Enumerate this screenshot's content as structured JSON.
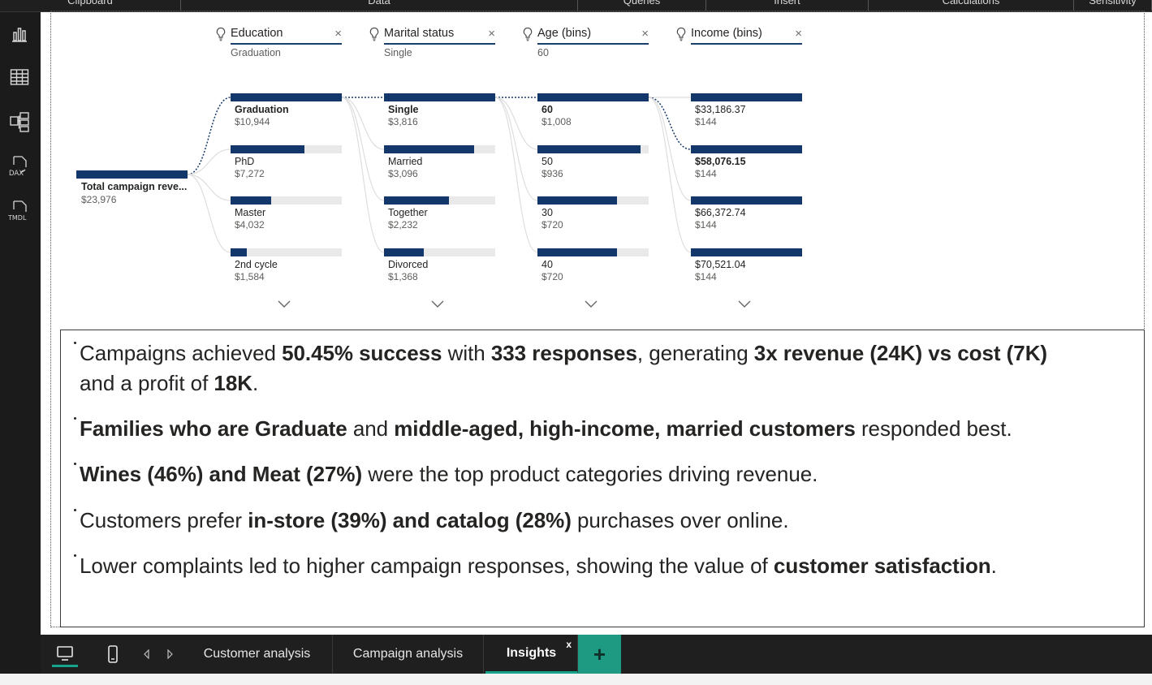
{
  "ribbon": {
    "groups": [
      "Clipboard",
      "Data",
      "Queries",
      "Insert",
      "Calculations",
      "Sensitivity"
    ]
  },
  "rail": {
    "icons": [
      "report-view-icon",
      "table-view-icon",
      "model-view-icon",
      "dax-query-view-icon",
      "tmdl-view-icon"
    ],
    "dax_label": "DAX",
    "tmdl_label": "TMDL"
  },
  "tree": {
    "root": {
      "label": "Total campaign reve...",
      "value": "$23,976"
    },
    "levels": [
      {
        "name": "Education",
        "selected": "Graduation",
        "nodes": [
          {
            "label": "Graduation",
            "value": "$10,944",
            "fraction": 1.0,
            "selected": true
          },
          {
            "label": "PhD",
            "value": "$7,272",
            "fraction": 0.664,
            "selected": false
          },
          {
            "label": "Master",
            "value": "$4,032",
            "fraction": 0.368,
            "selected": false
          },
          {
            "label": "2nd cycle",
            "value": "$1,584",
            "fraction": 0.145,
            "selected": false
          }
        ]
      },
      {
        "name": "Marital status",
        "selected": "Single",
        "nodes": [
          {
            "label": "Single",
            "value": "$3,816",
            "fraction": 1.0,
            "selected": true
          },
          {
            "label": "Married",
            "value": "$3,096",
            "fraction": 0.811,
            "selected": false
          },
          {
            "label": "Together",
            "value": "$2,232",
            "fraction": 0.585,
            "selected": false
          },
          {
            "label": "Divorced",
            "value": "$1,368",
            "fraction": 0.358,
            "selected": false
          }
        ]
      },
      {
        "name": "Age (bins)",
        "selected": "60",
        "nodes": [
          {
            "label": "60",
            "value": "$1,008",
            "fraction": 1.0,
            "selected": true
          },
          {
            "label": "50",
            "value": "$936",
            "fraction": 0.929,
            "selected": false
          },
          {
            "label": "30",
            "value": "$720",
            "fraction": 0.714,
            "selected": false
          },
          {
            "label": "40",
            "value": "$720",
            "fraction": 0.714,
            "selected": false
          }
        ]
      },
      {
        "name": "Income (bins)",
        "selected": "",
        "nodes": [
          {
            "label": "$33,186.37",
            "value": "$144",
            "fraction": 1.0,
            "selected": false
          },
          {
            "label": "$58,076.15",
            "value": "$144",
            "fraction": 1.0,
            "selected": true
          },
          {
            "label": "$66,372.74",
            "value": "$144",
            "fraction": 1.0,
            "selected": false
          },
          {
            "label": "$70,521.04",
            "value": "$144",
            "fraction": 1.0,
            "selected": false
          }
        ]
      }
    ],
    "close_glyph": "×"
  },
  "insights": {
    "lines": [
      [
        {
          "t": "Campaigns achieved ",
          "b": false
        },
        {
          "t": "50.45% success",
          "b": true
        },
        {
          "t": " with ",
          "b": false
        },
        {
          "t": "333 responses",
          "b": true
        },
        {
          "t": ", generating ",
          "b": false
        },
        {
          "t": "3x revenue (24K) vs cost (7K)",
          "b": true
        }
      ],
      [
        {
          "t": "and a profit of ",
          "b": false
        },
        {
          "t": "18K",
          "b": true
        },
        {
          "t": ".",
          "b": false
        }
      ],
      [
        {
          "t": "Families who are Graduate",
          "b": true
        },
        {
          "t": " and ",
          "b": false
        },
        {
          "t": "middle-aged, high-income, married customers",
          "b": true
        },
        {
          "t": " responded best.",
          "b": false
        }
      ],
      [
        {
          "t": "Wines (46%) and Meat (27%)",
          "b": true
        },
        {
          "t": " were the top product categories driving revenue.",
          "b": false
        }
      ],
      [
        {
          "t": "Customers prefer ",
          "b": false
        },
        {
          "t": "in-store (39%) and catalog (28%)",
          "b": true
        },
        {
          "t": " purchases over online.",
          "b": false
        }
      ],
      [
        {
          "t": "Lower complaints led to higher campaign responses, showing the value of ",
          "b": false
        },
        {
          "t": "customer satisfaction",
          "b": true
        },
        {
          "t": ".",
          "b": false
        }
      ]
    ]
  },
  "tabs": {
    "items": [
      {
        "label": "Customer analysis",
        "active": false
      },
      {
        "label": "Campaign analysis",
        "active": false
      },
      {
        "label": "Insights",
        "active": true
      }
    ],
    "close_glyph": "x",
    "add_glyph": "+"
  },
  "colors": {
    "bar": "#13376b",
    "track": "#e9e9e9",
    "accent": "#1e9a83"
  }
}
